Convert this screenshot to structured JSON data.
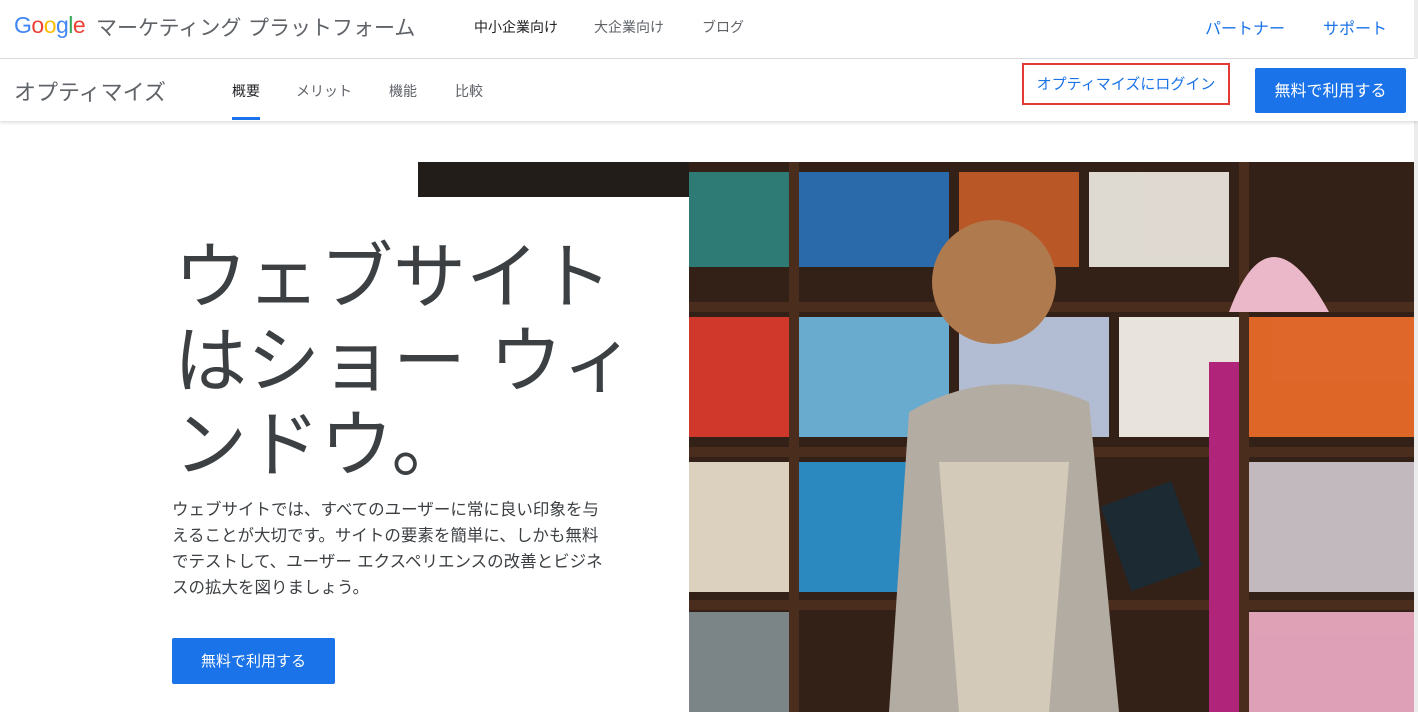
{
  "header": {
    "logo": "Google",
    "brand": "マーケティング プラットフォーム",
    "nav": [
      "中小企業向け",
      "大企業向け",
      "ブログ"
    ],
    "right_links": [
      "パートナー",
      "サポート"
    ]
  },
  "subheader": {
    "product": "オプティマイズ",
    "tabs": [
      "概要",
      "メリット",
      "機能",
      "比較"
    ],
    "login": "オプティマイズにログイン",
    "cta": "無料で利用する"
  },
  "hero": {
    "headline_lines": [
      "ウェブサイト",
      "はショー ウィ",
      "ンドウ。"
    ],
    "body_lines": [
      "ウェブサイトでは、すべてのユーザーに常に良い印象を与",
      "えることが大切です。サイトの要素を簡単に、しかも無料",
      "でテストして、ユーザー エクスペリエンスの改善とビジネ",
      "スの拡大を図りましょう。"
    ],
    "cta": "無料で利用する"
  },
  "colors": {
    "accent": "#1a73e8",
    "highlight_border": "#e53935",
    "google_blue": "#4285F4",
    "google_red": "#EA4335",
    "google_yellow": "#FBBC05",
    "google_green": "#34A853"
  }
}
